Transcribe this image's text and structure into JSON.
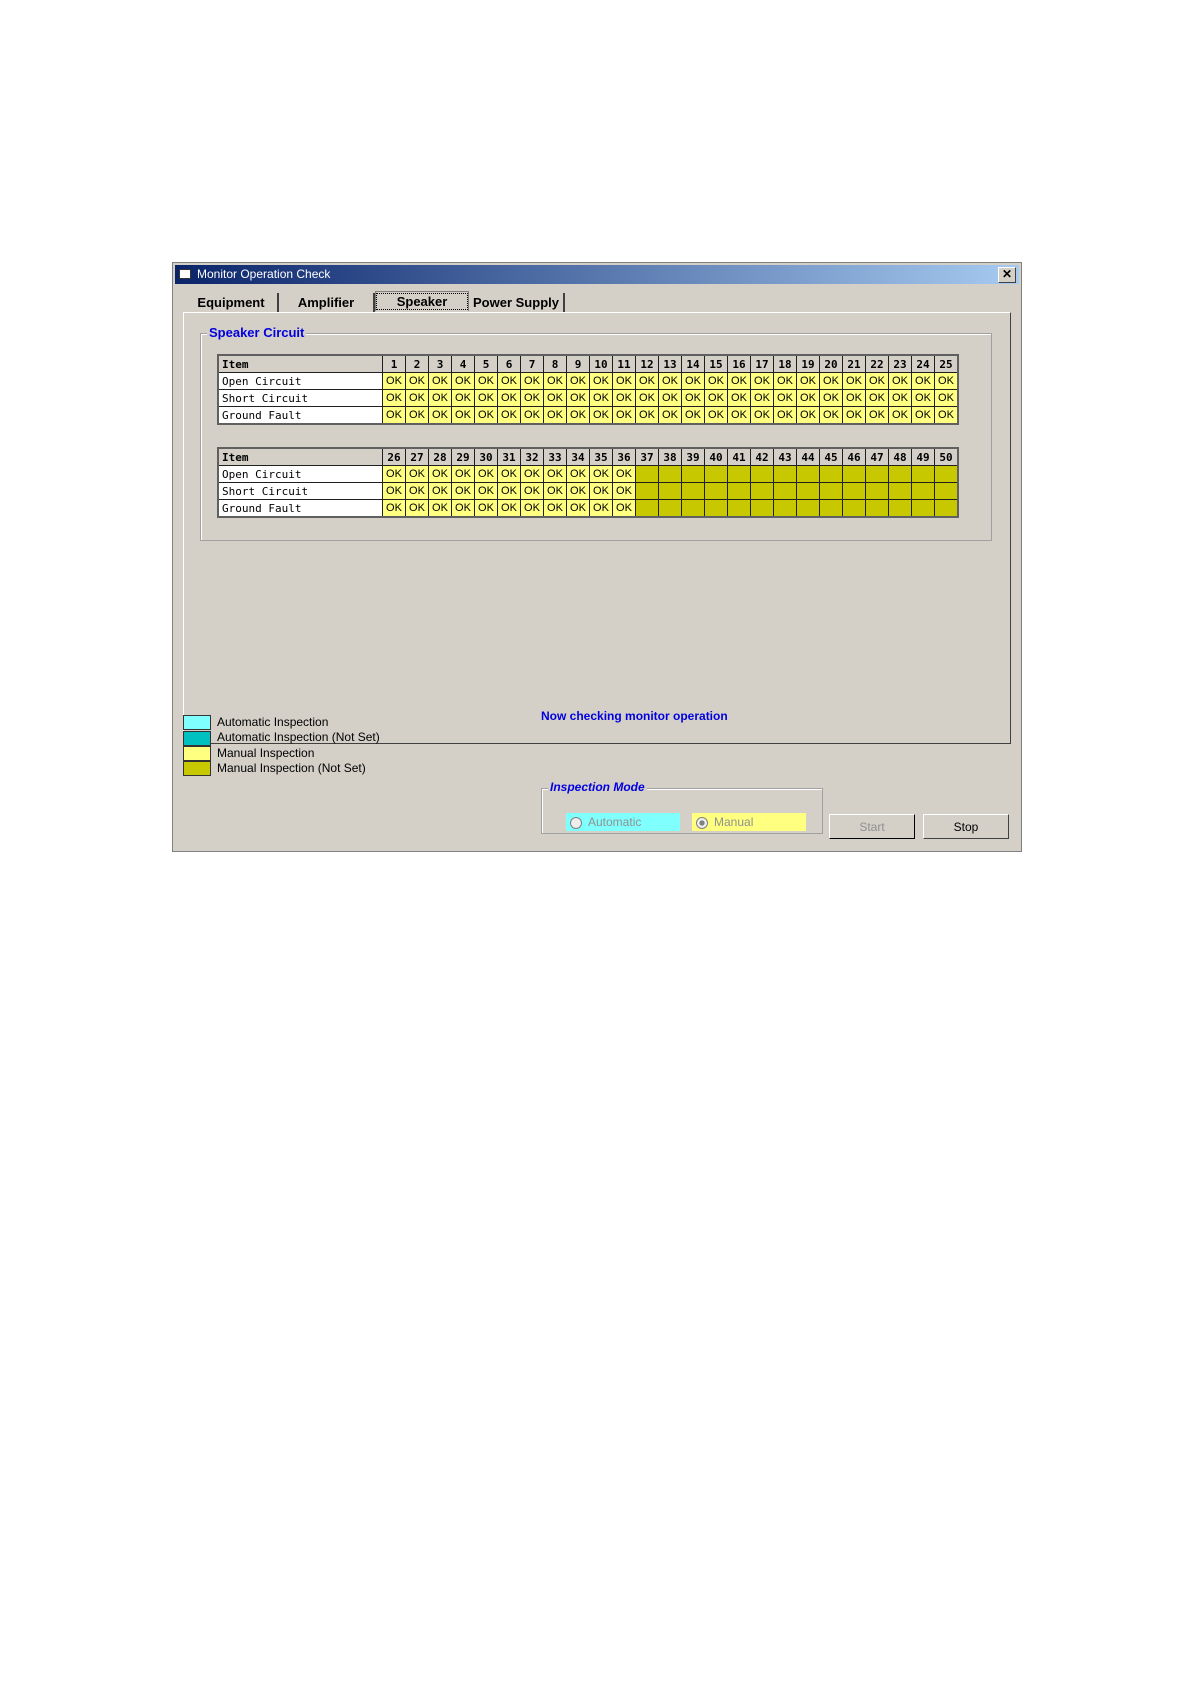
{
  "window": {
    "title": "Monitor Operation Check",
    "close_label": "✕"
  },
  "tabs": [
    {
      "label": "Equipment"
    },
    {
      "label": "Amplifier"
    },
    {
      "label": "Speaker",
      "active": true
    },
    {
      "label": "Power Supply"
    }
  ],
  "group_title": "Speaker Circuit",
  "tables": [
    {
      "header": "Item",
      "channels": [
        "1",
        "2",
        "3",
        "4",
        "5",
        "6",
        "7",
        "8",
        "9",
        "10",
        "11",
        "12",
        "13",
        "14",
        "15",
        "16",
        "17",
        "18",
        "19",
        "20",
        "21",
        "22",
        "23",
        "24",
        "25"
      ],
      "rows": [
        {
          "label": "Open Circuit",
          "values": [
            "OK",
            "OK",
            "OK",
            "OK",
            "OK",
            "OK",
            "OK",
            "OK",
            "OK",
            "OK",
            "OK",
            "OK",
            "OK",
            "OK",
            "OK",
            "OK",
            "OK",
            "OK",
            "OK",
            "OK",
            "OK",
            "OK",
            "OK",
            "OK",
            "OK"
          ]
        },
        {
          "label": "Short Circuit",
          "values": [
            "OK",
            "OK",
            "OK",
            "OK",
            "OK",
            "OK",
            "OK",
            "OK",
            "OK",
            "OK",
            "OK",
            "OK",
            "OK",
            "OK",
            "OK",
            "OK",
            "OK",
            "OK",
            "OK",
            "OK",
            "OK",
            "OK",
            "OK",
            "OK",
            "OK"
          ]
        },
        {
          "label": "Ground Fault",
          "values": [
            "OK",
            "OK",
            "OK",
            "OK",
            "OK",
            "OK",
            "OK",
            "OK",
            "OK",
            "OK",
            "OK",
            "OK",
            "OK",
            "OK",
            "OK",
            "OK",
            "OK",
            "OK",
            "OK",
            "OK",
            "OK",
            "OK",
            "OK",
            "OK",
            "OK"
          ]
        }
      ]
    },
    {
      "header": "Item",
      "channels": [
        "26",
        "27",
        "28",
        "29",
        "30",
        "31",
        "32",
        "33",
        "34",
        "35",
        "36",
        "37",
        "38",
        "39",
        "40",
        "41",
        "42",
        "43",
        "44",
        "45",
        "46",
        "47",
        "48",
        "49",
        "50"
      ],
      "rows": [
        {
          "label": "Open Circuit",
          "values": [
            "OK",
            "OK",
            "OK",
            "OK",
            "OK",
            "OK",
            "OK",
            "OK",
            "OK",
            "OK",
            "OK",
            "",
            "",
            "",
            "",
            "",
            "",
            "",
            "",
            "",
            "",
            "",
            "",
            "",
            ""
          ]
        },
        {
          "label": "Short Circuit",
          "values": [
            "OK",
            "OK",
            "OK",
            "OK",
            "OK",
            "OK",
            "OK",
            "OK",
            "OK",
            "OK",
            "OK",
            "",
            "",
            "",
            "",
            "",
            "",
            "",
            "",
            "",
            "",
            "",
            "",
            "",
            ""
          ]
        },
        {
          "label": "Ground Fault",
          "values": [
            "OK",
            "OK",
            "OK",
            "OK",
            "OK",
            "OK",
            "OK",
            "OK",
            "OK",
            "OK",
            "OK",
            "",
            "",
            "",
            "",
            "",
            "",
            "",
            "",
            "",
            "",
            "",
            "",
            "",
            ""
          ]
        }
      ]
    }
  ],
  "legend": [
    {
      "label": "Automatic Inspection",
      "color": "#80ffff"
    },
    {
      "label": "Automatic Inspection (Not Set)",
      "color": "#00c0c0"
    },
    {
      "label": "Manual Inspection",
      "color": "#ffff80"
    },
    {
      "label": "Manual Inspection (Not Set)",
      "color": "#c8c800"
    }
  ],
  "status": "Now checking monitor operation",
  "inspection_mode": {
    "title": "Inspection Mode",
    "automatic": "Automatic",
    "manual": "Manual",
    "selected": "Manual"
  },
  "buttons": {
    "start": "Start",
    "stop": "Stop"
  }
}
